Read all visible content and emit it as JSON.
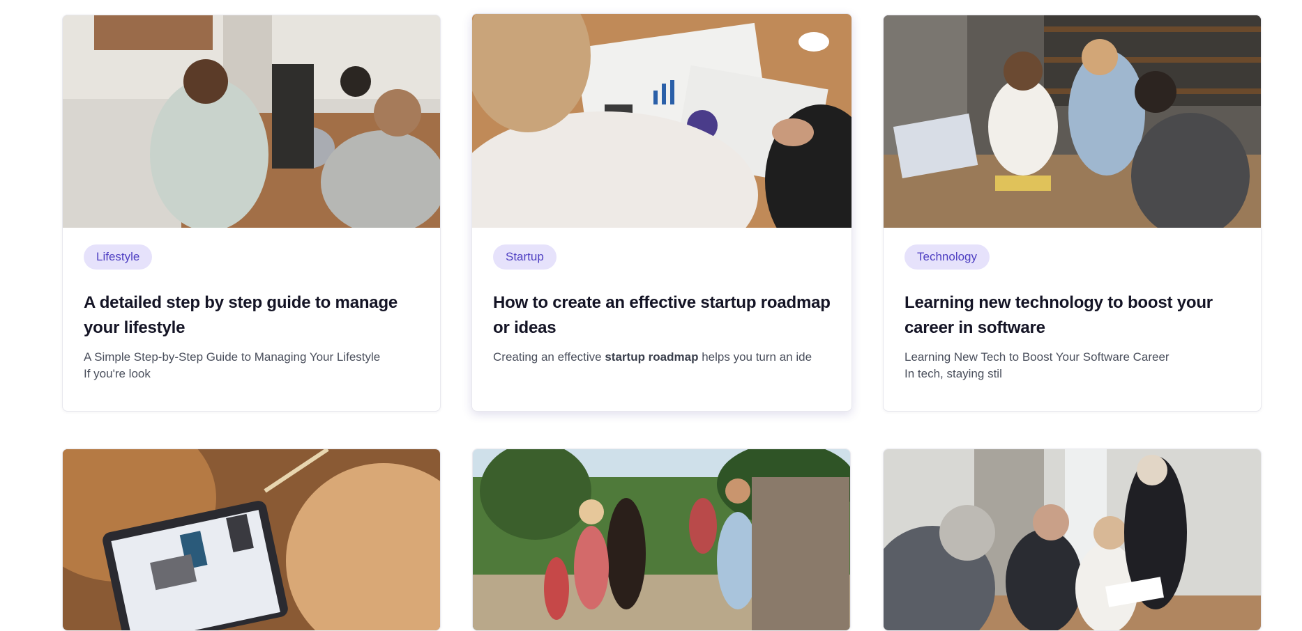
{
  "cards": [
    {
      "tag": "Lifestyle",
      "title": "A detailed step by step guide to manage your lifestyle",
      "excerpt_line1": "A Simple Step-by-Step Guide to Managing Your Lifestyle",
      "excerpt_line2": "If you're look",
      "image": "office-meeting-photo"
    },
    {
      "tag": "Startup",
      "title": "How to create an effective startup roadmap or ideas",
      "excerpt_pre": "Creating an effective ",
      "excerpt_bold": "startup roadmap",
      "excerpt_post": " helps you turn an ide",
      "image": "charts-on-table-photo"
    },
    {
      "tag": "Technology",
      "title": "Learning new technology to boost your career in software",
      "excerpt_line1": "Learning New Tech to Boost Your Software Career",
      "excerpt_line2": "In tech, staying stil",
      "image": "students-laptop-photo"
    },
    {
      "image": "tablet-design-photo"
    },
    {
      "image": "family-horse-photo"
    },
    {
      "image": "business-team-photo"
    }
  ],
  "colors": {
    "tag_bg": "#e6e2fb",
    "tag_text": "#4e3fc2",
    "title": "#141425",
    "excerpt": "#4a4f5c"
  }
}
